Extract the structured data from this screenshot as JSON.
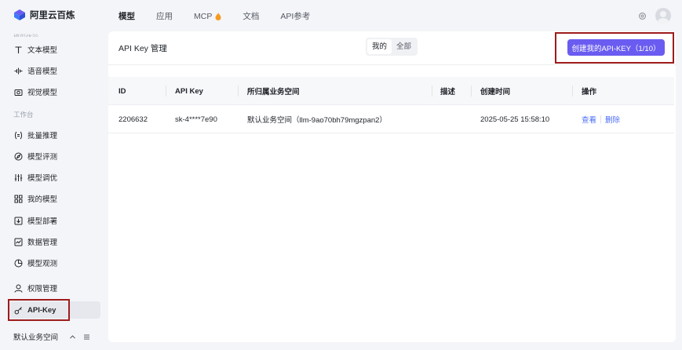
{
  "app": {
    "name": "阿里云百炼"
  },
  "nav": {
    "items": [
      "模型",
      "应用",
      "MCP",
      "文档",
      "API参考"
    ]
  },
  "sidebar": {
    "faded_header": "模型体验",
    "items": [
      {
        "label": "文本模型",
        "icon": "text-icon"
      },
      {
        "label": "语音模型",
        "icon": "waveform-icon"
      },
      {
        "label": "视觉模型",
        "icon": "camera-icon"
      }
    ],
    "section": "工作台",
    "work_items": [
      {
        "label": "批量推理",
        "icon": "batch-icon"
      },
      {
        "label": "模型评测",
        "icon": "compass-icon"
      },
      {
        "label": "模型调优",
        "icon": "tune-icon"
      },
      {
        "label": "我的模型",
        "icon": "grid-icon"
      },
      {
        "label": "模型部署",
        "icon": "deploy-icon"
      },
      {
        "label": "数据管理",
        "icon": "chart-icon"
      },
      {
        "label": "模型观测",
        "icon": "pie-icon"
      }
    ],
    "perm": {
      "label": "权限管理",
      "icon": "user-icon"
    },
    "apikey": {
      "label": "API-Key",
      "icon": "key-icon"
    },
    "workspace": "默认业务空间"
  },
  "main": {
    "title": "API Key 管理",
    "segments": [
      "我的",
      "全部"
    ],
    "create_button": "创建我的API-KEY（1/10）",
    "columns": [
      "ID",
      "API Key",
      "所归属业务空间",
      "描述",
      "创建时间",
      "操作"
    ],
    "rows": [
      {
        "id": "2206632",
        "key": "sk-4****7e90",
        "workspace": "默认业务空间（llm-9ao70bh79mgzpan2）",
        "desc": "",
        "created": "2025-05-25 15:58:10",
        "actions": [
          "查看",
          "删除"
        ]
      }
    ]
  },
  "colors": {
    "accent": "#6a5cf0",
    "link": "#4a6cf7",
    "highlight": "#9e1c1c"
  }
}
